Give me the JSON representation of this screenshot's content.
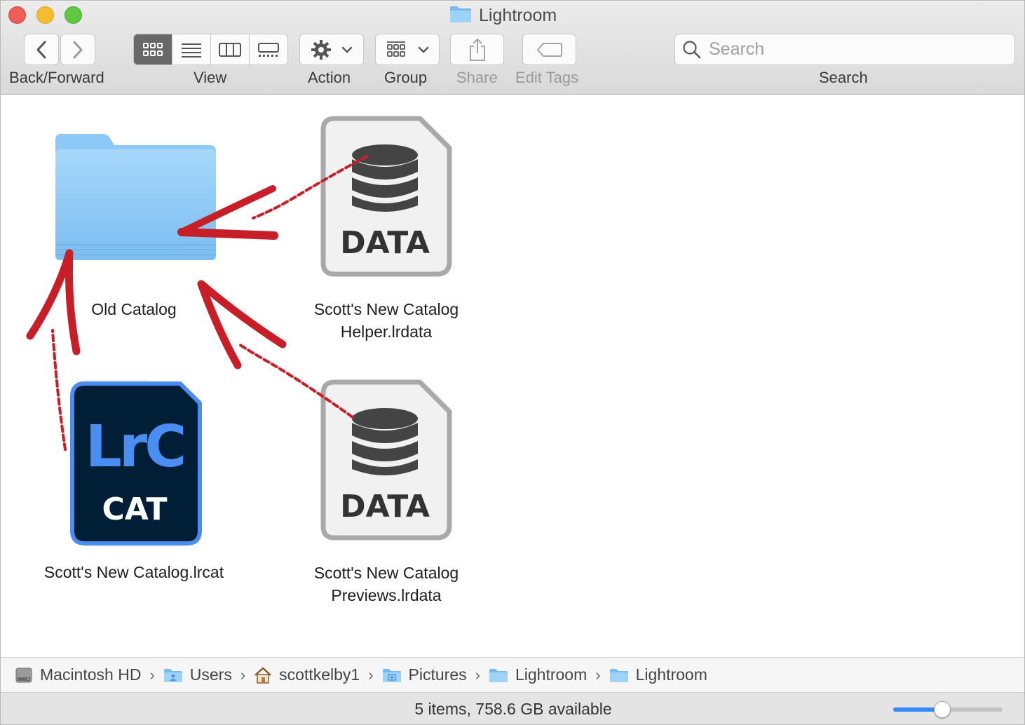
{
  "window": {
    "title": "Lightroom"
  },
  "toolbar": {
    "back_forward_label": "Back/Forward",
    "view_label": "View",
    "action_label": "Action",
    "group_label": "Group",
    "share_label": "Share",
    "edit_tags_label": "Edit Tags",
    "search_label": "Search",
    "search_placeholder": "Search",
    "active_view": "icon"
  },
  "files": [
    {
      "name": "Old Catalog",
      "kind": "folder"
    },
    {
      "name_line1": "Scott's New Catalog",
      "name_line2": "Helper.lrdata",
      "kind": "data",
      "icon_text": "DATA"
    },
    {
      "name": "Scott's New Catalog.lrcat",
      "kind": "lrcat",
      "icon_text_top": "LrC",
      "icon_text_bottom": "CAT"
    },
    {
      "name_line1": "Scott's New Catalog",
      "name_line2": "Previews.lrdata",
      "kind": "data",
      "icon_text": "DATA"
    }
  ],
  "path": [
    {
      "label": "Macintosh HD",
      "icon": "disk-icon"
    },
    {
      "label": "Users",
      "icon": "users-folder-icon"
    },
    {
      "label": "scottkelby1",
      "icon": "home-icon"
    },
    {
      "label": "Pictures",
      "icon": "pictures-folder-icon"
    },
    {
      "label": "Lightroom",
      "icon": "folder-icon"
    },
    {
      "label": "Lightroom",
      "icon": "folder-icon"
    }
  ],
  "status": {
    "text": "5 items, 758.6 GB available",
    "zoom_level": 0.45
  },
  "colors": {
    "annotation": "#c81e28",
    "folder": "#8cc8f5",
    "lrc_bg": "#001e36",
    "lrc_accent": "#31a8ff"
  }
}
